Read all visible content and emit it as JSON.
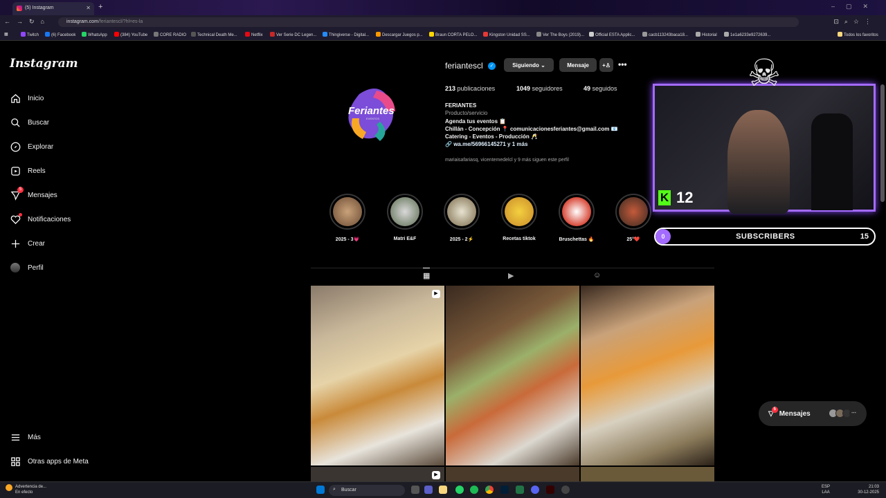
{
  "browser": {
    "tab_title": "(5) Instagram",
    "url_host": "instagram.com",
    "url_path": "/feriantescl/?hl=es-la",
    "bookmarks": [
      "Twitch",
      "(6) Facebook",
      "WhatsApp",
      "(384) YouTube",
      "CORE RADIO",
      "Technical Death Me...",
      "Netflix",
      "Ver Serie DC Legen...",
      "Thingiverse - Digital...",
      "Descargar Juegos p...",
      "Braun CORTA PELO...",
      "Kingston Unidad SS...",
      "Ver The Boys (2019)...",
      "Official ESTA Applic...",
      "cacb113243baca18...",
      "Historial",
      "1e1a6233e9272639...",
      "Todos los favoritos"
    ]
  },
  "sidebar": {
    "logo": "Instagram",
    "items": [
      {
        "label": "Inicio",
        "icon": "home-icon"
      },
      {
        "label": "Buscar",
        "icon": "search-icon"
      },
      {
        "label": "Explorar",
        "icon": "compass-icon"
      },
      {
        "label": "Reels",
        "icon": "reels-icon"
      },
      {
        "label": "Mensajes",
        "icon": "messenger-icon",
        "badge": "5"
      },
      {
        "label": "Notificaciones",
        "icon": "heart-icon"
      },
      {
        "label": "Crear",
        "icon": "plus-icon"
      },
      {
        "label": "Perfil",
        "icon": "avatar-icon"
      }
    ],
    "more": "Más",
    "meta_apps": "Otras apps de Meta"
  },
  "profile": {
    "avatar_text": "Feriantes",
    "avatar_sub": "EVENTOS",
    "username": "feriantescl",
    "follow_button": "Siguiendo",
    "message_button": "Mensaje",
    "stats": {
      "posts": "213",
      "posts_label": "publicaciones",
      "followers": "1049",
      "followers_label": "seguidores",
      "following": "49",
      "following_label": "seguidos"
    },
    "name": "FERIANTES",
    "category": "Producto/servicio",
    "bio_lines": [
      "Agenda tus eventos 📋",
      "Chillán - Concepción 📍 comunicacionesferiantes@gmail.com 📧",
      "Catering - Eventos - Producción 🥂"
    ],
    "link": "wa.me/56966145271 y 1 más",
    "followed_by": "mariaisafariasq, vicentemedelcl y 9 más siguen este perfil"
  },
  "highlights": [
    {
      "label": "2025 - 3💗"
    },
    {
      "label": "Matri E&F"
    },
    {
      "label": "2025 - 2⚡"
    },
    {
      "label": "Recetas tiktok"
    },
    {
      "label": "Bruschettas 🔥"
    },
    {
      "label": "25°❤️"
    }
  ],
  "overlay": {
    "kick_count": "12",
    "subs_current": "0",
    "subs_label": "SUBSCRIBERS",
    "subs_goal": "15"
  },
  "messages_bubble": {
    "label": "Mensajes",
    "badge": "5"
  },
  "taskbar": {
    "warning_title": "Advertencia de...",
    "warning_sub": "En efecto",
    "search_placeholder": "Buscar",
    "lang_1": "ESP",
    "lang_2": "LAA",
    "time": "21:03",
    "date": "30-12-2025"
  }
}
